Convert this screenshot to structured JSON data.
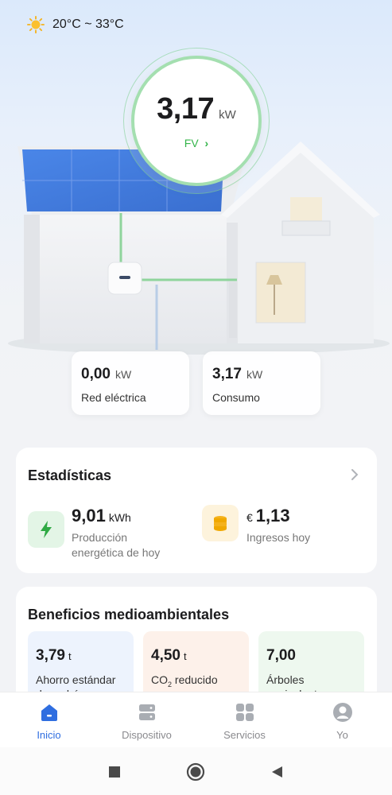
{
  "weather": {
    "icon": "sun-icon",
    "range": "20°C ~ 33°C"
  },
  "pv": {
    "value": "3,17",
    "unit": "kW",
    "label": "FV",
    "label_arrow": "›"
  },
  "flows": [
    {
      "value": "0,00",
      "unit": "kW",
      "label": "Red eléctrica"
    },
    {
      "value": "3,17",
      "unit": "kW",
      "label": "Consumo"
    }
  ],
  "stats": {
    "title": "Estadísticas",
    "production": {
      "icon": "lightning-icon",
      "value": "9,01",
      "unit": "kWh",
      "label_line1": "Producción",
      "label_line2": "energética de hoy"
    },
    "income": {
      "icon": "coins-icon",
      "currency": "€",
      "value": "1,13",
      "label": "Ingresos hoy"
    }
  },
  "benefits": {
    "title": "Beneficios medioambientales",
    "items": [
      {
        "value": "3,79",
        "unit": "t",
        "label_line1": "Ahorro estándar",
        "label_line2": "de carbón",
        "bg": "#edf3fd"
      },
      {
        "value": "4,50",
        "unit": "t",
        "label_main": "CO",
        "label_sub": "2",
        "label_rest": " reducido",
        "bg": "#fdf1ea"
      },
      {
        "value": "7,00",
        "unit": "",
        "label_line1": "Árboles",
        "label_line2": "equivalentes",
        "bg": "#eef8ef"
      }
    ]
  },
  "tabs": [
    {
      "label": "Inicio",
      "icon": "home-icon",
      "active": true
    },
    {
      "label": "Dispositivo",
      "icon": "device-icon",
      "active": false
    },
    {
      "label": "Servicios",
      "icon": "grid-icon",
      "active": false
    },
    {
      "label": "Yo",
      "icon": "user-icon",
      "active": false
    }
  ],
  "colors": {
    "accent": "#2f6ee0",
    "pv_green": "#34b44a",
    "grid_line": "#b9cde6"
  }
}
